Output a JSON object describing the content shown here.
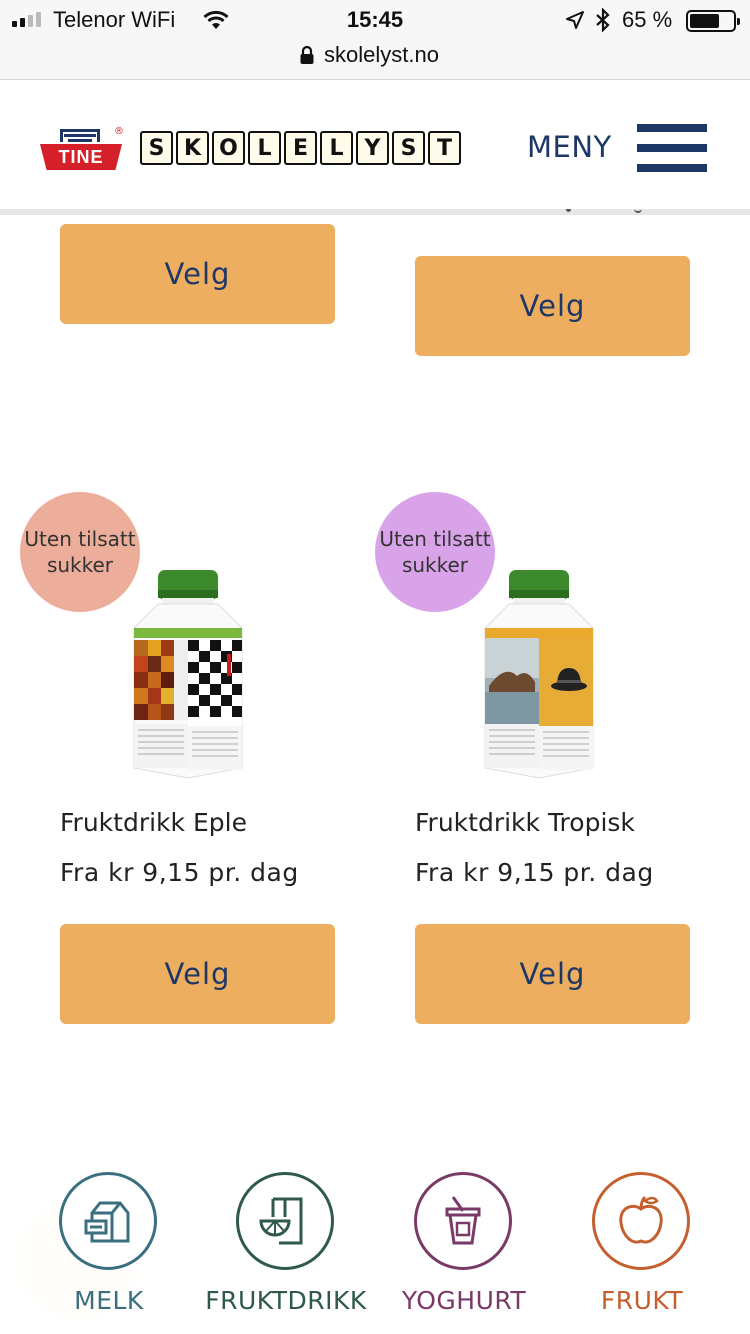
{
  "status_bar": {
    "carrier": "Telenor WiFi",
    "time": "15:45",
    "battery_percent": "65 %"
  },
  "browser": {
    "url": "skolelyst.no"
  },
  "header": {
    "tine_logo_text": "TINE",
    "skolelyst_letters": [
      "S",
      "K",
      "O",
      "L",
      "E",
      "L",
      "Y",
      "S",
      "T"
    ],
    "menu_label": "MENY"
  },
  "products": [
    {
      "button_label": "Velg"
    },
    {
      "button_label": "Velg"
    },
    {
      "badge": "Uten tilsatt sukker",
      "badge_color": "#ecad9a",
      "name": "Fruktdrikk Eple",
      "price": "Fra kr 9,15 pr. dag",
      "button_label": "Velg",
      "carton_label": "EPLE"
    },
    {
      "badge": "Uten tilsatt sukker",
      "badge_color": "#d9a3ea",
      "name": "Fruktdrikk Tropisk",
      "price": "Fra kr 9,15 pr. dag",
      "button_label": "Velg",
      "carton_label": "TROPISK"
    }
  ],
  "bottom_nav": [
    {
      "label": "MELK",
      "icon": "milk-carton-icon",
      "color": "#3a6f80"
    },
    {
      "label": "FRUKTDRIKK",
      "icon": "juice-glass-icon",
      "color": "#2f5a4a"
    },
    {
      "label": "YOGHURT",
      "icon": "yoghurt-cup-icon",
      "color": "#7a3a68"
    },
    {
      "label": "FRUKT",
      "icon": "apple-icon",
      "color": "#c4602f"
    }
  ],
  "colors": {
    "button": "#edae5f",
    "navy": "#1d3767",
    "tine_red": "#d5202a"
  }
}
